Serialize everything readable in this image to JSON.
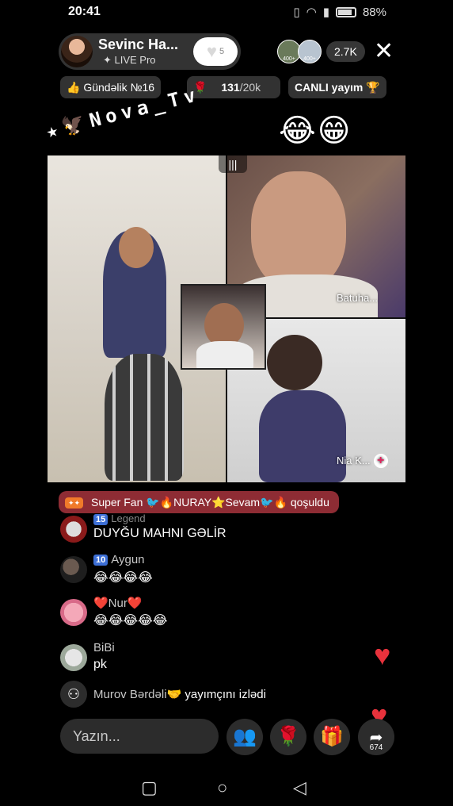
{
  "status_bar": {
    "time": "20:41",
    "battery": "88%"
  },
  "host": {
    "name": "Sevinc Ha...",
    "subtitle": "✦ LIVE Pro",
    "follow_count": "5"
  },
  "viewers": {
    "badge_a": "400+",
    "badge_b": "400+",
    "count": "2.7K"
  },
  "pills": {
    "daily": "Gündəlik №16",
    "goal_current": "131",
    "goal_total": "/20k",
    "live": "CANLI yayım"
  },
  "overlay": {
    "emojis": "😂😁",
    "brand": "★🦅Nova_Tv"
  },
  "video_tiles": [
    {
      "label": ""
    },
    {
      "label": "Batuha..."
    },
    {
      "label": "Nia K..."
    }
  ],
  "join_banner": {
    "badge": "Super Fan",
    "text": "🐦🔥NURAY⭐Sevam🐦🔥 qoşuldu"
  },
  "chat": [
    {
      "name": "Legend",
      "level": "15",
      "message": "DUYĞU MAHNI GƏLİR"
    },
    {
      "name": "Aygun",
      "level": "10",
      "message": "😂😂😂😂"
    },
    {
      "name": "❤️Nur❤️",
      "level": "",
      "message": "😂😂😂😂😂"
    },
    {
      "name": "BiBi",
      "level": "",
      "message": "pk"
    }
  ],
  "follow_notice": {
    "user": "Murov Bərdəli🤝",
    "text": "yayımçını izlədi"
  },
  "composer": {
    "placeholder": "Yazın..."
  },
  "actions": {
    "share_count": "674"
  },
  "colors": {
    "join_banner": "#8e2c34",
    "level_badge": "#3d6fd6",
    "heart": "#e8323c"
  }
}
